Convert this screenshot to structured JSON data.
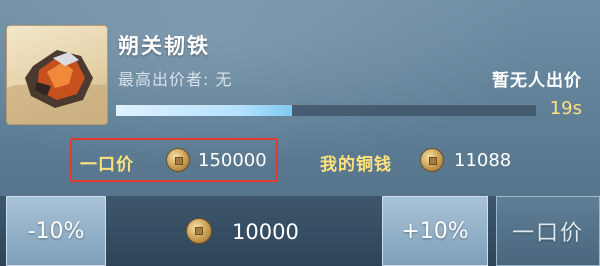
{
  "item": {
    "name": "朔关韧铁",
    "icon": "ore-chunk-icon"
  },
  "auction": {
    "highest_bidder": "最高出价者: 无",
    "status": "暂无人出价",
    "timer": "19s",
    "progress_fraction": 0.42
  },
  "buyout": {
    "label": "一口价",
    "value": "150000"
  },
  "wallet": {
    "label": "我的铜钱",
    "value": "11088"
  },
  "bid_controls": {
    "decrease_label": "-10%",
    "bid_value": "10000",
    "increase_label": "+10%",
    "buyout_button_label": "一口价"
  },
  "colors": {
    "gold_text": "#ffe27a",
    "highlight_border": "#e23a2e",
    "progress_fill": "#b6e2ff"
  }
}
